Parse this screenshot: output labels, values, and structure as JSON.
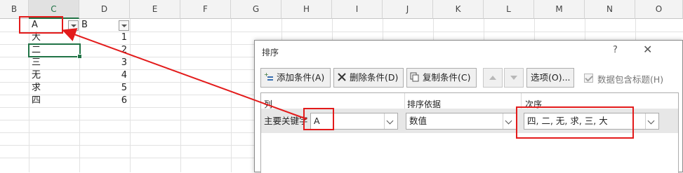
{
  "sheet": {
    "columns": [
      "B",
      "C",
      "D",
      "E",
      "F",
      "G",
      "H",
      "I",
      "J",
      "K",
      "L",
      "M",
      "N",
      "O"
    ],
    "header_row": {
      "a": "A",
      "b": "B"
    },
    "rows": [
      {
        "a": "大",
        "b": "1"
      },
      {
        "a": "二",
        "b": "2"
      },
      {
        "a": "三",
        "b": "3"
      },
      {
        "a": "无",
        "b": "4"
      },
      {
        "a": "求",
        "b": "5"
      },
      {
        "a": "四",
        "b": "6"
      }
    ]
  },
  "dialog": {
    "title": "排序",
    "help": "?",
    "close": "✕",
    "buttons": {
      "add": "添加条件(A)",
      "delete": "删除条件(D)",
      "copy": "复制条件(C)",
      "options": "选项(O)..."
    },
    "checkbox_label": "数据包含标题(H)",
    "headers": {
      "column": "列",
      "sort_on": "排序依据",
      "order": "次序"
    },
    "row": {
      "label": "主要关键字",
      "column_value": "A",
      "sort_on_value": "数值",
      "order_value": "四, 二, 无, 求, 三, 大"
    }
  },
  "colors": {
    "annotation": "#e31b1b",
    "excel_green": "#217346"
  },
  "icons": [
    "add-condition-icon",
    "delete-x-icon",
    "copy-icon",
    "up-arrow-icon",
    "down-arrow-icon",
    "close-icon",
    "help-icon",
    "filter-dropdown-icon"
  ]
}
